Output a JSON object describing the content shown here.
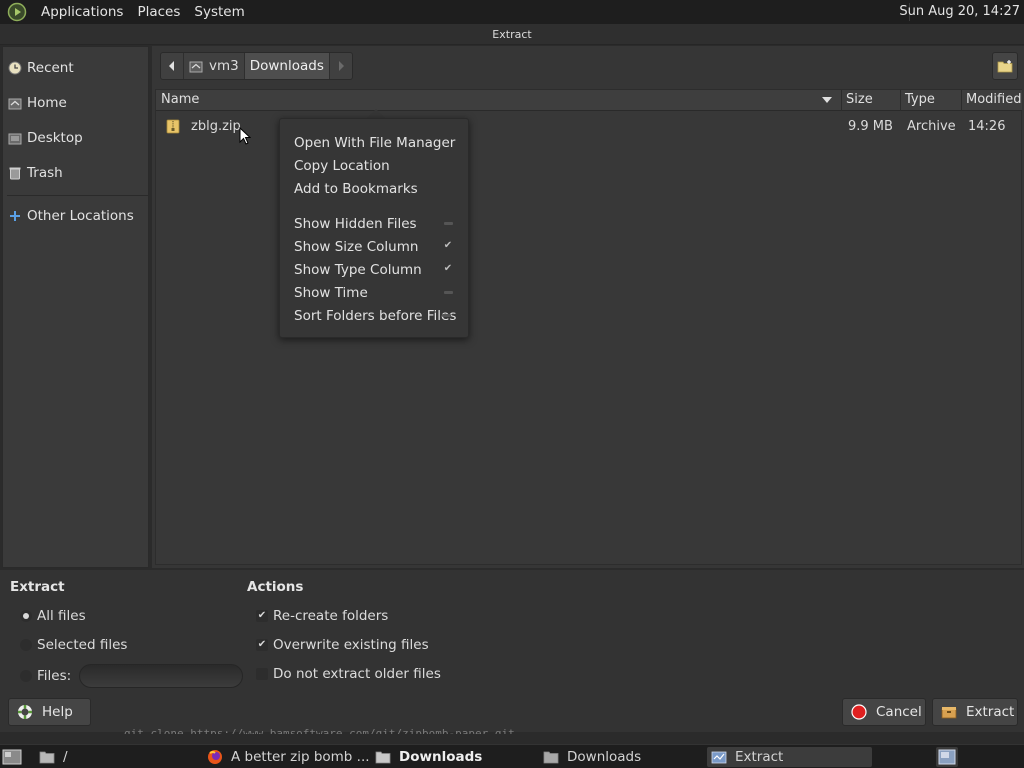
{
  "top_panel": {
    "menus": [
      "Applications",
      "Places",
      "System"
    ],
    "clock": "Sun Aug 20, 14:27"
  },
  "window": {
    "title": "Extract"
  },
  "sidebar": {
    "items": [
      {
        "label": "Recent",
        "icon": "clock-icon"
      },
      {
        "label": "Home",
        "icon": "home-icon"
      },
      {
        "label": "Desktop",
        "icon": "desktop-icon"
      },
      {
        "label": "Trash",
        "icon": "trash-icon"
      },
      {
        "label": "Other Locations",
        "icon": "plus-icon"
      }
    ]
  },
  "pathbar": {
    "segments": [
      "vm3",
      "Downloads"
    ]
  },
  "columns": {
    "name": "Name",
    "size": "Size",
    "type": "Type",
    "modified": "Modified"
  },
  "files": [
    {
      "name": "zblg.zip",
      "size": "9.9 MB",
      "type": "Archive",
      "modified": "14:26"
    }
  ],
  "context_menu": {
    "items": [
      {
        "label": "Open With File Manager"
      },
      {
        "label": "Copy Location"
      },
      {
        "label": "Add to Bookmarks"
      },
      {
        "label": "Show Hidden Files",
        "checked": false
      },
      {
        "label": "Show Size Column",
        "checked": true
      },
      {
        "label": "Show Type Column",
        "checked": true
      },
      {
        "label": "Show Time",
        "checked": false
      },
      {
        "label": "Sort Folders before Files",
        "checked": false
      }
    ]
  },
  "extract_options": {
    "heading": "Extract",
    "all_files": "All files",
    "selected_files": "Selected files",
    "files": "Files:",
    "files_value": "",
    "selected": "all_files"
  },
  "actions": {
    "heading": "Actions",
    "recreate_folders": {
      "label": "Re-create folders",
      "checked": true
    },
    "overwrite": {
      "label": "Overwrite existing files",
      "checked": true
    },
    "no_older": {
      "label": "Do not extract older files",
      "checked": false
    }
  },
  "buttons": {
    "help": "Help",
    "cancel": "Cancel",
    "extract": "Extract"
  },
  "behind_window_text": "git clone https://www.bamsoftware.com/git/zipbomb-paper.git",
  "taskbar": {
    "items": [
      {
        "label": "/"
      },
      {
        "label": "A better zip bomb ..."
      },
      {
        "label": "Downloads"
      },
      {
        "label": "Downloads"
      },
      {
        "label": "Extract"
      }
    ]
  },
  "colors": {
    "accent_red": "#e02020",
    "folder_yellow": "#e8c468"
  }
}
